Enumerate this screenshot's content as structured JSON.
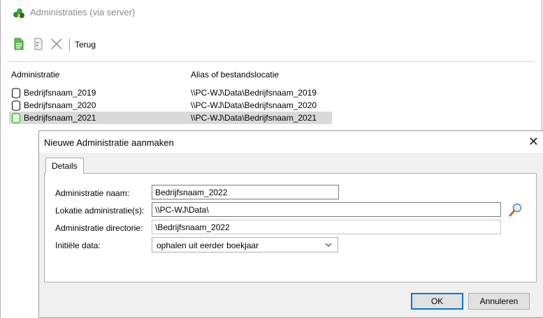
{
  "window": {
    "title": "Administraties (via server)"
  },
  "toolbar": {
    "new_icon": "new-document-icon",
    "copy_icon": "copy-document-icon",
    "delete_icon": "delete-x-icon",
    "back_label": "Terug"
  },
  "list": {
    "columns": [
      "Administratie",
      "Alias of bestandslocatie"
    ],
    "rows": [
      {
        "name": "Bedrijfsnaam_2019",
        "path": "\\\\PC-WJ\\Data\\Bedrijfsnaam_2019",
        "selected": false
      },
      {
        "name": "Bedrijfsnaam_2020",
        "path": "\\\\PC-WJ\\Data\\Bedrijfsnaam_2020",
        "selected": false
      },
      {
        "name": "Bedrijfsnaam_2021",
        "path": "\\\\PC-WJ\\Data\\Bedrijfsnaam_2021",
        "selected": true
      }
    ]
  },
  "dialog": {
    "title": "Nieuwe Administratie aanmaken",
    "close_glyph": "✕",
    "tab_label": "Details",
    "fields": {
      "name_label": "Administratie naam:",
      "name_value": "Bedrijfsnaam_2022",
      "location_label": "Lokatie administratie(s):",
      "location_value": "\\\\PC-WJ\\Data\\",
      "directory_label": "Administratie directorie:",
      "directory_value": "\\Bedrijfsnaam_2022",
      "initial_label": "Initiële data:",
      "initial_value": "ophalen uit eerder boekjaar"
    },
    "ok_label": "OK",
    "cancel_label": "Annuleren"
  },
  "colors": {
    "accent": "#0078d7",
    "db_icon_green": "#2fbf3a",
    "selected_row": "#d9d9d9"
  }
}
